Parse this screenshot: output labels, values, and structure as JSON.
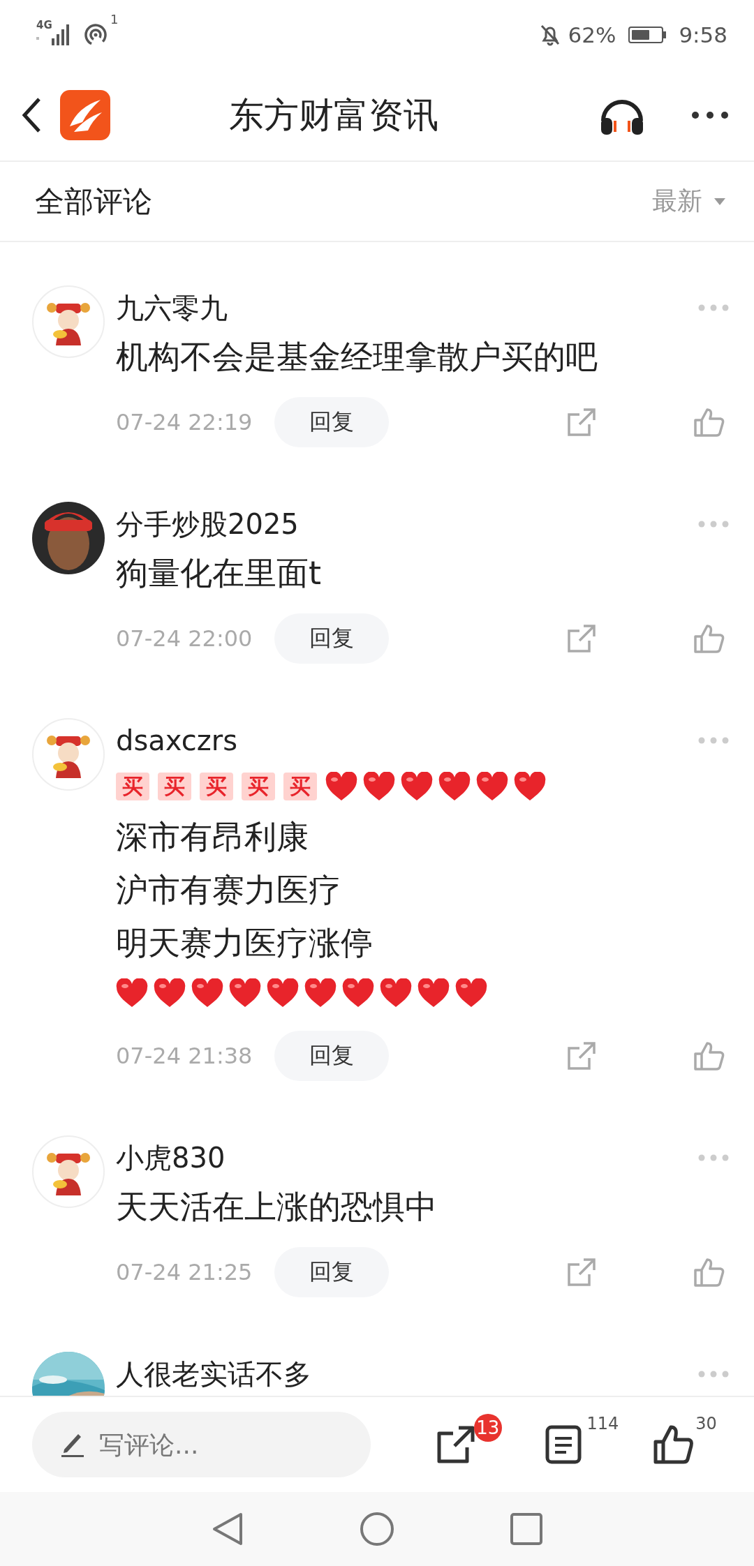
{
  "status_bar": {
    "network": "4G",
    "hotspot_count": "1",
    "battery": "62%",
    "time": "9:58",
    "muted": true
  },
  "header": {
    "title": "东方财富资讯"
  },
  "filter": {
    "label": "全部评论",
    "sort": "最新"
  },
  "comments": [
    {
      "avatar": {
        "kind": "figure"
      },
      "name": "九六零九",
      "lines": [
        {
          "kind": "text",
          "text": "机构不会是基金经理拿散户买的吧"
        }
      ],
      "time": "07-24 22:19",
      "reply": "回复"
    },
    {
      "avatar": {
        "kind": "person"
      },
      "name": "分手炒股2025",
      "lines": [
        {
          "kind": "text",
          "text": "狗量化在里面t"
        }
      ],
      "time": "07-24 22:00",
      "reply": "回复"
    },
    {
      "avatar": {
        "kind": "figure"
      },
      "name": "dsaxczrs",
      "lines": [
        {
          "kind": "emoji",
          "items": [
            {
              "kind": "sticker",
              "text": "买"
            },
            {
              "kind": "sticker",
              "text": "买"
            },
            {
              "kind": "sticker",
              "text": "买"
            },
            {
              "kind": "sticker",
              "text": "买"
            },
            {
              "kind": "sticker",
              "text": "买"
            },
            {
              "kind": "heart"
            },
            {
              "kind": "heart"
            },
            {
              "kind": "heart"
            },
            {
              "kind": "heart"
            },
            {
              "kind": "heart"
            },
            {
              "kind": "heart"
            }
          ]
        },
        {
          "kind": "text",
          "text": "深市有昂利康"
        },
        {
          "kind": "text",
          "text": "沪市有赛力医疗"
        },
        {
          "kind": "text",
          "text": "明天赛力医疗涨停"
        },
        {
          "kind": "emoji",
          "items": [
            {
              "kind": "heart"
            },
            {
              "kind": "heart"
            },
            {
              "kind": "heart"
            },
            {
              "kind": "heart"
            },
            {
              "kind": "heart"
            },
            {
              "kind": "heart"
            },
            {
              "kind": "heart"
            },
            {
              "kind": "heart"
            },
            {
              "kind": "heart"
            },
            {
              "kind": "heart"
            }
          ]
        }
      ],
      "time": "07-24 21:38",
      "reply": "回复"
    },
    {
      "avatar": {
        "kind": "figure"
      },
      "name": "小虎830",
      "lines": [
        {
          "kind": "text",
          "text": "天天活在上涨的恐惧中"
        }
      ],
      "time": "07-24 21:25",
      "reply": "回复"
    },
    {
      "name": "人很老实话不多"
    }
  ],
  "bottom_bar": {
    "placeholder": "写评论...",
    "share_count": "13",
    "comment_count": "114",
    "like_count": "30"
  }
}
